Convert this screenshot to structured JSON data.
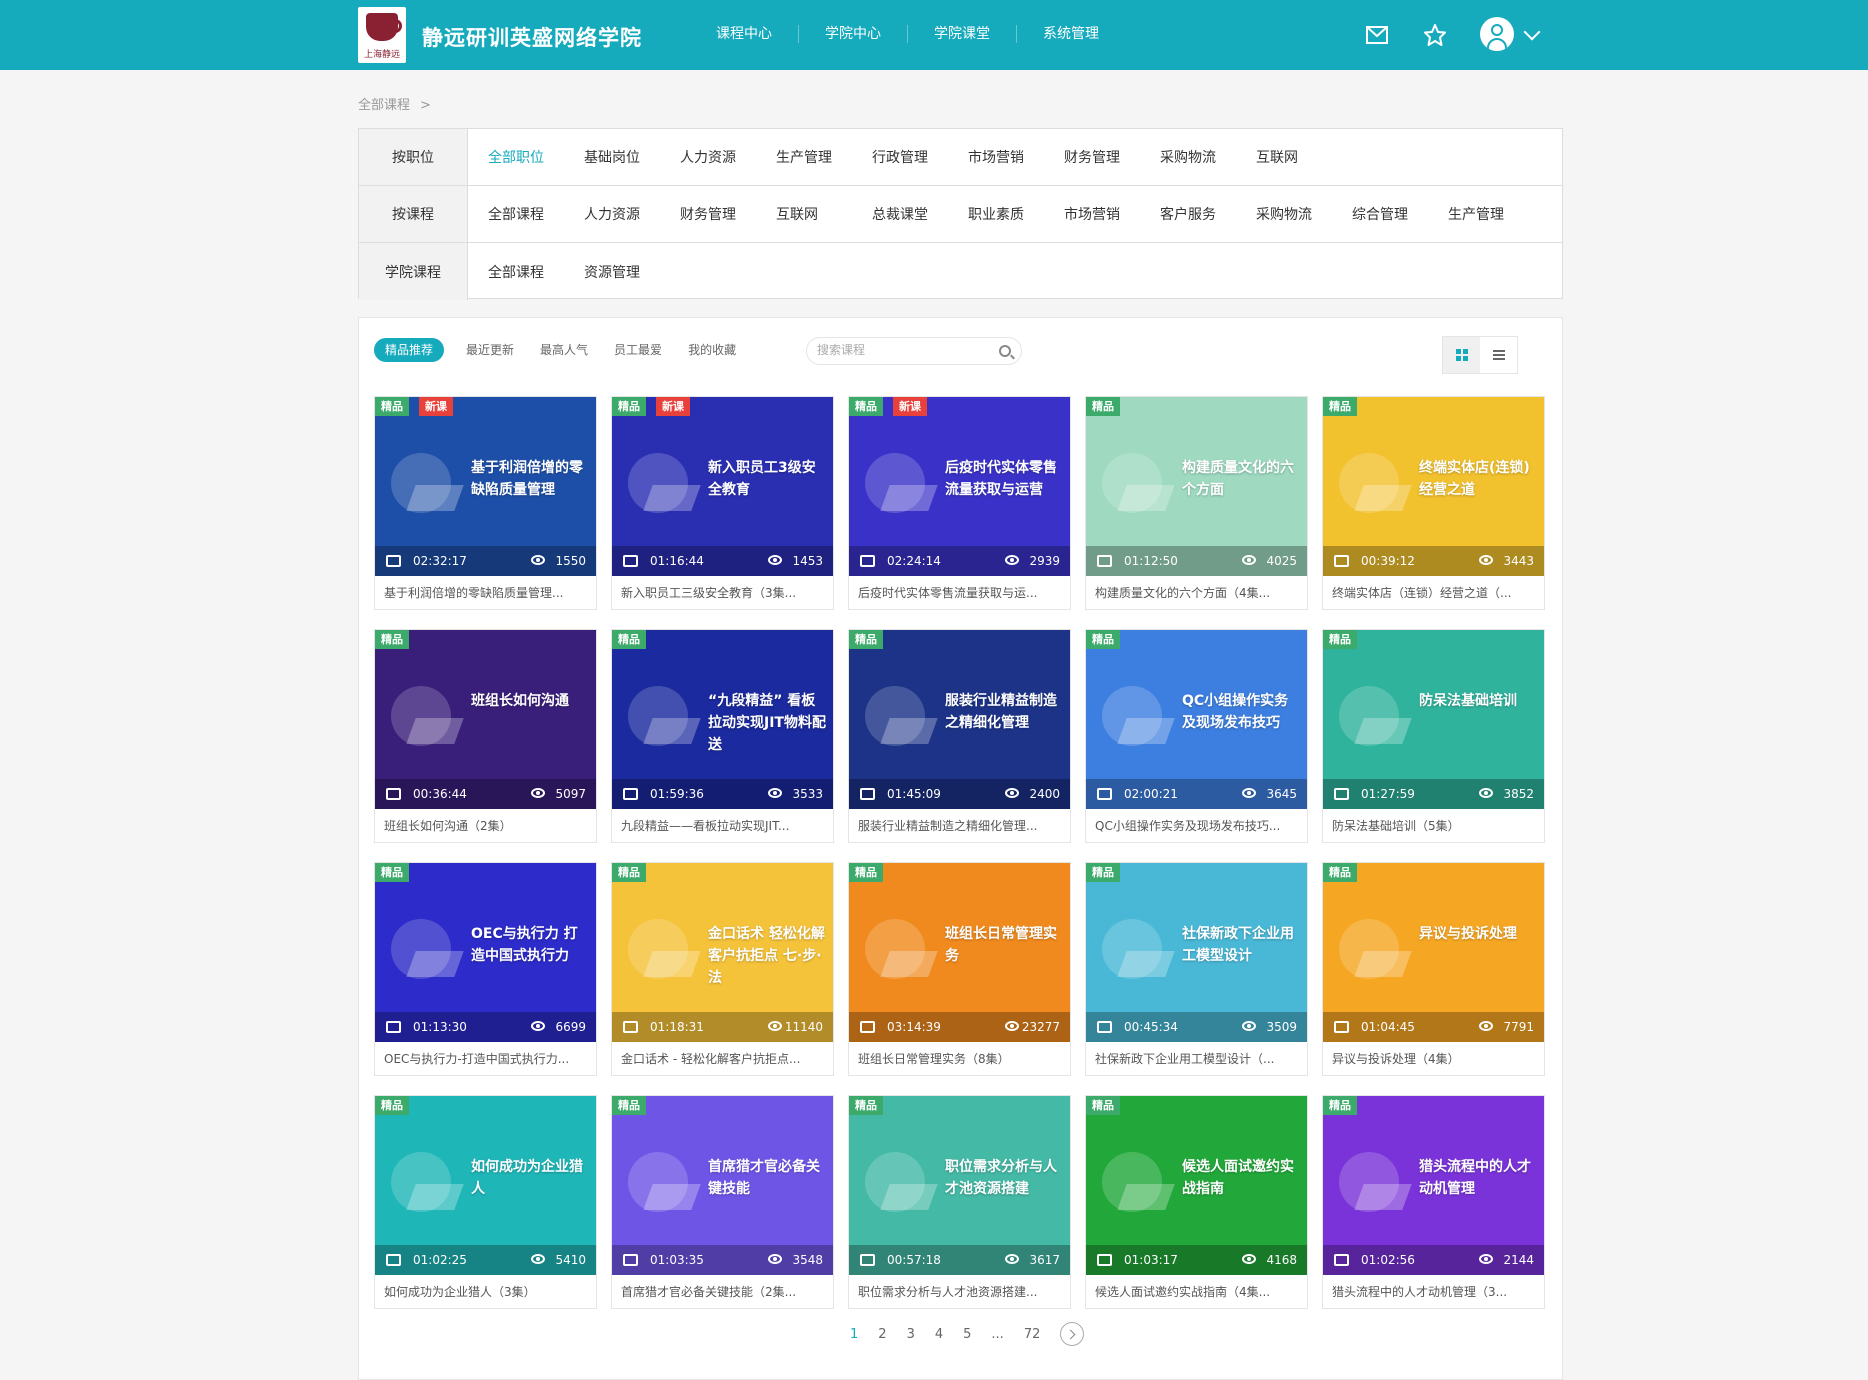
{
  "header": {
    "logo_text": "上海静远",
    "site_title": "静远研训英盛网络学院",
    "nav": [
      "课程中心",
      "学院中心",
      "学院课堂",
      "系统管理"
    ]
  },
  "breadcrumb": {
    "label": "全部课程",
    "sep": ">"
  },
  "filters": [
    {
      "label": "按职位",
      "options": [
        "全部职位",
        "基础岗位",
        "人力资源",
        "生产管理",
        "行政管理",
        "市场营销",
        "财务管理",
        "采购物流",
        "互联网"
      ],
      "active": 0
    },
    {
      "label": "按课程",
      "options": [
        "全部课程",
        "人力资源",
        "财务管理",
        "互联网",
        "总裁课堂",
        "职业素质",
        "市场营销",
        "客户服务",
        "采购物流",
        "综合管理",
        "生产管理"
      ],
      "active": -1
    },
    {
      "label": "学院课程",
      "options": [
        "全部课程",
        "资源管理"
      ],
      "active": -1
    }
  ],
  "tabs": [
    "精品推荐",
    "最近更新",
    "最高人气",
    "员工最爱",
    "我的收藏"
  ],
  "search": {
    "placeholder": "搜索课程"
  },
  "badges": {
    "jingpin": "精品",
    "xinke": "新课"
  },
  "courses": [
    {
      "thumb_title": "基于利润倍增的零缺陷质量管理",
      "name": "基于利润倍增的零缺陷质量管理...",
      "duration": "02:32:17",
      "views": "1550",
      "jingpin": true,
      "xinke": true,
      "color": "#1e4fa8"
    },
    {
      "thumb_title": "新入职员工3级安全教育",
      "name": "新入职员工三级安全教育（3集...",
      "duration": "01:16:44",
      "views": "1453",
      "jingpin": true,
      "xinke": true,
      "color": "#2a2fb2"
    },
    {
      "thumb_title": "后疫时代实体零售流量获取与运营",
      "name": "后疫时代实体零售流量获取与运...",
      "duration": "02:24:14",
      "views": "2939",
      "jingpin": true,
      "xinke": true,
      "color": "#3a32c8"
    },
    {
      "thumb_title": "构建质量文化的六个方面",
      "name": "构建质量文化的六个方面（4集...",
      "duration": "01:12:50",
      "views": "4025",
      "jingpin": true,
      "xinke": false,
      "color": "#9ed9c0"
    },
    {
      "thumb_title": "终端实体店(连锁)经营之道",
      "name": "终端实体店（连锁）经营之道（...",
      "duration": "00:39:12",
      "views": "3443",
      "jingpin": true,
      "xinke": false,
      "color": "#f2c12e"
    },
    {
      "thumb_title": "班组长如何沟通",
      "name": "班组长如何沟通（2集）",
      "duration": "00:36:44",
      "views": "5097",
      "jingpin": true,
      "xinke": false,
      "color": "#3a1f7a"
    },
    {
      "thumb_title": "“九段精益” 看板拉动实现JIT物料配送",
      "name": "九段精益——看板拉动实现JIT...",
      "duration": "01:59:36",
      "views": "3533",
      "jingpin": true,
      "xinke": false,
      "color": "#1b2a9e"
    },
    {
      "thumb_title": "服装行业精益制造之精细化管理",
      "name": "服装行业精益制造之精细化管理...",
      "duration": "01:45:09",
      "views": "2400",
      "jingpin": true,
      "xinke": false,
      "color": "#1c3388"
    },
    {
      "thumb_title": "QC小组操作实务及现场发布技巧",
      "name": "QC小组操作实务及现场发布技巧...",
      "duration": "02:00:21",
      "views": "3645",
      "jingpin": true,
      "xinke": false,
      "color": "#3d7fe0"
    },
    {
      "thumb_title": "防呆法基础培训",
      "name": "防呆法基础培训（5集）",
      "duration": "01:27:59",
      "views": "3852",
      "jingpin": true,
      "xinke": false,
      "color": "#2fb39c"
    },
    {
      "thumb_title": "OEC与执行力 打造中国式执行力",
      "name": "OEC与执行力-打造中国式执行力...",
      "duration": "01:13:30",
      "views": "6699",
      "jingpin": true,
      "xinke": false,
      "color": "#2d2bc9"
    },
    {
      "thumb_title": "金口话术 轻松化解客户抗拒点 七·步·法",
      "name": "金口话术 - 轻松化解客户抗拒点...",
      "duration": "01:18:31",
      "views": "11140",
      "jingpin": true,
      "xinke": false,
      "color": "#f5c33a"
    },
    {
      "thumb_title": "班组长日常管理实务",
      "name": "班组长日常管理实务（8集）",
      "duration": "03:14:39",
      "views": "23277",
      "jingpin": true,
      "xinke": false,
      "color": "#f08a1e"
    },
    {
      "thumb_title": "社保新政下企业用工模型设计",
      "name": "社保新政下企业用工模型设计（...",
      "duration": "00:45:34",
      "views": "3509",
      "jingpin": true,
      "xinke": false,
      "color": "#49b8d6"
    },
    {
      "thumb_title": "异议与投诉处理",
      "name": "异议与投诉处理（4集）",
      "duration": "01:04:45",
      "views": "7791",
      "jingpin": true,
      "xinke": false,
      "color": "#f5a623"
    },
    {
      "thumb_title": "如何成功为企业猎人",
      "name": "如何成功为企业猎人（3集）",
      "duration": "01:02:25",
      "views": "5410",
      "jingpin": true,
      "xinke": false,
      "color": "#1fb6b8"
    },
    {
      "thumb_title": "首席猎才官必备关键技能",
      "name": "首席猎才官必备关键技能（2集...",
      "duration": "01:03:35",
      "views": "3548",
      "jingpin": true,
      "xinke": false,
      "color": "#6f55e6"
    },
    {
      "thumb_title": "职位需求分析与人才池资源搭建",
      "name": "职位需求分析与人才池资源搭建...",
      "duration": "00:57:18",
      "views": "3617",
      "jingpin": true,
      "xinke": false,
      "color": "#44b9a6"
    },
    {
      "thumb_title": "候选人面试邀约实战指南",
      "name": "候选人面试邀约实战指南（4集...",
      "duration": "01:03:17",
      "views": "4168",
      "jingpin": true,
      "xinke": false,
      "color": "#22a83a"
    },
    {
      "thumb_title": "猎头流程中的人才动机管理",
      "name": "猎头流程中的人才动机管理（3...",
      "duration": "01:02:56",
      "views": "2144",
      "jingpin": true,
      "xinke": false,
      "color": "#7a33d8"
    }
  ],
  "pagination": {
    "pages": [
      "1",
      "2",
      "3",
      "4",
      "5",
      "...",
      "72"
    ],
    "current": "1"
  }
}
